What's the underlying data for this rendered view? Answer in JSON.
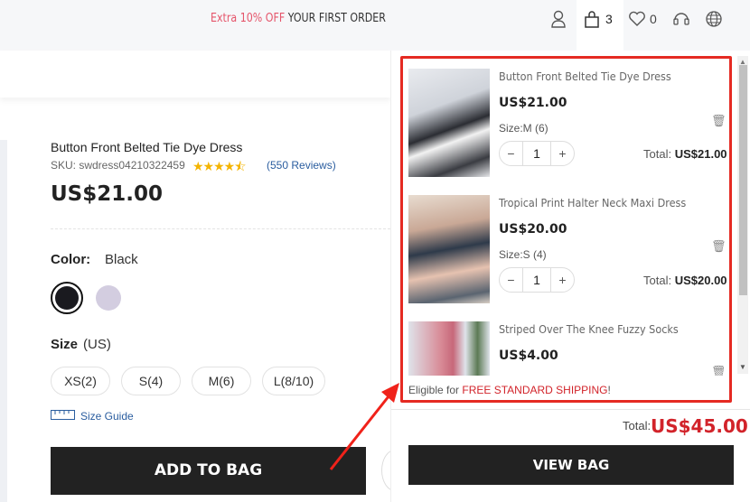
{
  "topbar": {
    "promo_highlight": "Extra 10% OFF",
    "promo_rest": " YOUR FIRST ORDER",
    "bag_count": "3",
    "wishlist_count": "0"
  },
  "product": {
    "title": "Button Front Belted Tie Dye Dress",
    "sku": "SKU: swdress04210322459",
    "rating": 4.5,
    "stars": "★★★★⯪",
    "reviews": "(550 Reviews)",
    "price": "US$21.00",
    "color_label": "Color:",
    "color_value": "Black",
    "colors": [
      "#1a1a1f",
      "#d3cde0"
    ],
    "size_label": "Size",
    "size_unit": "(US)",
    "sizes": [
      "XS(2)",
      "S(4)",
      "M(6)",
      "L(8/10)"
    ],
    "size_guide": "Size Guide",
    "add_to_bag": "ADD TO BAG"
  },
  "cart": {
    "items": [
      {
        "name": "Button Front Belted Tie Dye Dress",
        "price": "US$21.00",
        "size": "Size:M (6)",
        "qty": "1",
        "total_label": "Total:",
        "total": "US$21.00"
      },
      {
        "name": "Tropical Print Halter Neck Maxi Dress",
        "price": "US$20.00",
        "size": "Size:S (4)",
        "qty": "1",
        "total_label": "Total:",
        "total": "US$20.00"
      },
      {
        "name": "Striped Over The Knee Fuzzy Socks",
        "price": "US$4.00"
      }
    ],
    "ship_prefix": "Eligible for ",
    "ship_highlight": "FREE STANDARD SHIPPING",
    "ship_suffix": "!",
    "total_label": "Total:",
    "total": "US$45.00",
    "view_bag": "VIEW BAG",
    "minus": "−",
    "plus": "+"
  },
  "colors": {
    "accent_red": "#d2232a",
    "promo_pink": "#e5546a",
    "button_dark": "#222222"
  }
}
